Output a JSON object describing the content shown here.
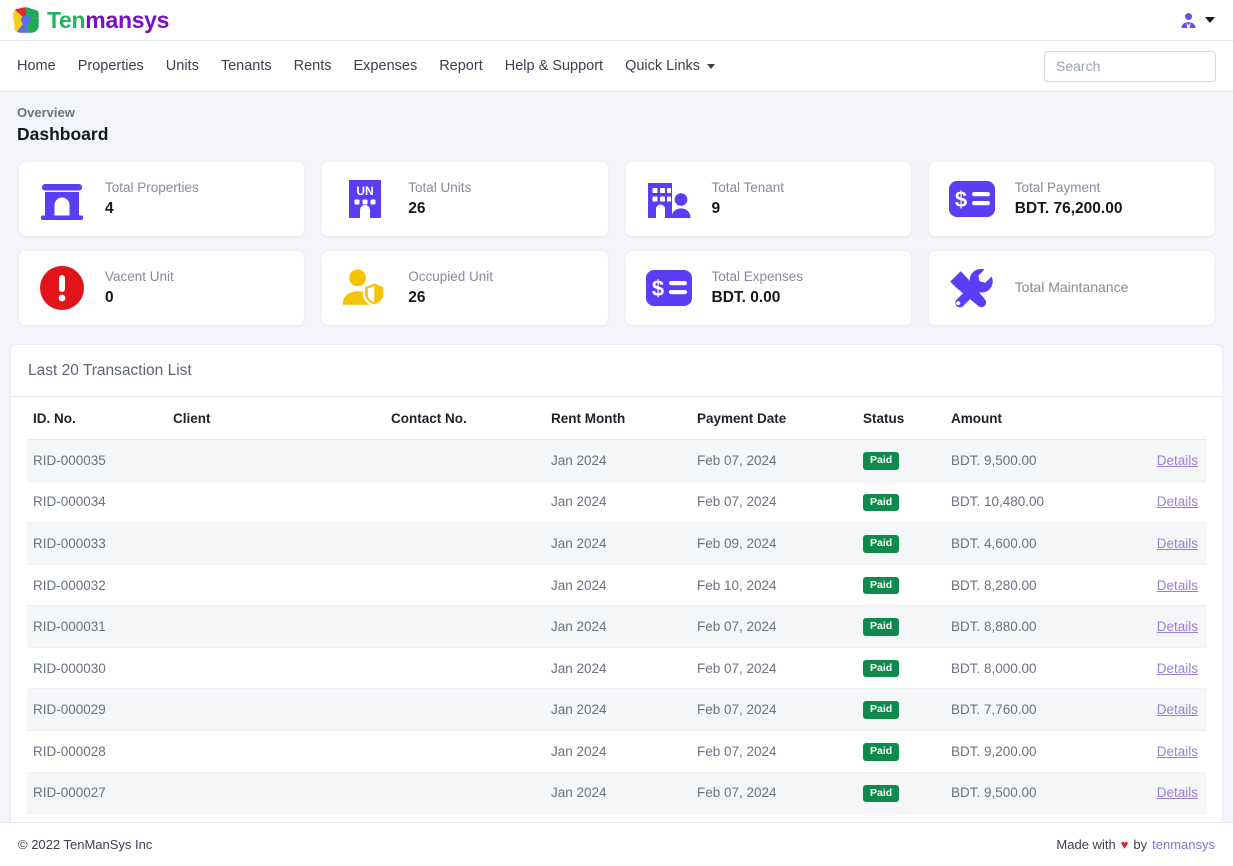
{
  "brand": {
    "name_part1": "Ten",
    "name_part2": "mansys",
    "logo_icon": "pie-logo-icon"
  },
  "topbar": {
    "avatar_icon": "user-avatar-icon",
    "caret_icon": "chevron-down-icon"
  },
  "nav": {
    "items": [
      {
        "label": "Home",
        "dropdown": false
      },
      {
        "label": "Properties",
        "dropdown": false
      },
      {
        "label": "Units",
        "dropdown": false
      },
      {
        "label": "Tenants",
        "dropdown": false
      },
      {
        "label": "Rents",
        "dropdown": false
      },
      {
        "label": "Expenses",
        "dropdown": false
      },
      {
        "label": "Report",
        "dropdown": false
      },
      {
        "label": "Help & Support",
        "dropdown": false
      },
      {
        "label": "Quick Links",
        "dropdown": true
      }
    ]
  },
  "search": {
    "placeholder": "Search",
    "value": ""
  },
  "page": {
    "eyebrow": "Overview",
    "title": "Dashboard"
  },
  "stats": [
    {
      "label": "Total Properties",
      "value": "4",
      "icon": "arch-building-icon",
      "color": "#5b3df5"
    },
    {
      "label": "Total Units",
      "value": "26",
      "icon": "unit-building-icon",
      "color": "#5b3df5"
    },
    {
      "label": "Total Tenant",
      "value": "9",
      "icon": "building-person-icon",
      "color": "#5b3df5"
    },
    {
      "label": "Total Payment",
      "value": "BDT. 76,200.00",
      "icon": "payment-card-icon",
      "color": "#5b3df5"
    },
    {
      "label": "Vacent Unit",
      "value": "0",
      "icon": "alert-circle-icon",
      "color": "#e11419"
    },
    {
      "label": "Occupied Unit",
      "value": "26",
      "icon": "person-shield-icon",
      "color": "#f5c400"
    },
    {
      "label": "Total Expenses",
      "value": "BDT. 0.00",
      "icon": "payment-card-icon",
      "color": "#5b3df5"
    },
    {
      "label": "Total Maintanance",
      "value": "",
      "icon": "tools-icon",
      "color": "#5b3df5"
    }
  ],
  "transactions": {
    "panel_title": "Last 20 Transaction List",
    "columns": [
      "ID. No.",
      "Client",
      "Contact No.",
      "Rent Month",
      "Payment Date",
      "Status",
      "Amount",
      ""
    ],
    "action_label": "Details",
    "rows": [
      {
        "id": "RID-000035",
        "client": "",
        "contact": "",
        "rent_month": "Jan 2024",
        "payment_date": "Feb 07, 2024",
        "status": "Paid",
        "amount": "BDT. 9,500.00",
        "action": "Details"
      },
      {
        "id": "RID-000034",
        "client": "",
        "contact": "",
        "rent_month": "Jan 2024",
        "payment_date": "Feb 07, 2024",
        "status": "Paid",
        "amount": "BDT. 10,480.00",
        "action": "Details"
      },
      {
        "id": "RID-000033",
        "client": "",
        "contact": "",
        "rent_month": "Jan 2024",
        "payment_date": "Feb 09, 2024",
        "status": "Paid",
        "amount": "BDT. 4,600.00",
        "action": "Details"
      },
      {
        "id": "RID-000032",
        "client": "",
        "contact": "",
        "rent_month": "Jan 2024",
        "payment_date": "Feb 10, 2024",
        "status": "Paid",
        "amount": "BDT. 8,280.00",
        "action": "Details"
      },
      {
        "id": "RID-000031",
        "client": "",
        "contact": "",
        "rent_month": "Jan 2024",
        "payment_date": "Feb 07, 2024",
        "status": "Paid",
        "amount": "BDT. 8,880.00",
        "action": "Details"
      },
      {
        "id": "RID-000030",
        "client": "",
        "contact": "",
        "rent_month": "Jan 2024",
        "payment_date": "Feb 07, 2024",
        "status": "Paid",
        "amount": "BDT. 8,000.00",
        "action": "Details"
      },
      {
        "id": "RID-000029",
        "client": "",
        "contact": "",
        "rent_month": "Jan 2024",
        "payment_date": "Feb 07, 2024",
        "status": "Paid",
        "amount": "BDT. 7,760.00",
        "action": "Details"
      },
      {
        "id": "RID-000028",
        "client": "",
        "contact": "",
        "rent_month": "Jan 2024",
        "payment_date": "Feb 07, 2024",
        "status": "Paid",
        "amount": "BDT. 9,200.00",
        "action": "Details"
      },
      {
        "id": "RID-000027",
        "client": "",
        "contact": "",
        "rent_month": "Jan 2024",
        "payment_date": "Feb 07, 2024",
        "status": "Paid",
        "amount": "BDT. 9,500.00",
        "action": "Details"
      }
    ]
  },
  "footer": {
    "copyright": "© 2022 TenManSys Inc",
    "made_with": "Made with",
    "heart": "♥",
    "by": "by",
    "brand_link": "tenmansys"
  },
  "colors": {
    "accent_purple": "#5b3df5",
    "link_purple": "#9b7fd4",
    "paid_green": "#0f8a4d",
    "alert_red": "#e11419",
    "occupied_yellow": "#f5c400",
    "page_bg": "#f4f5fa"
  }
}
